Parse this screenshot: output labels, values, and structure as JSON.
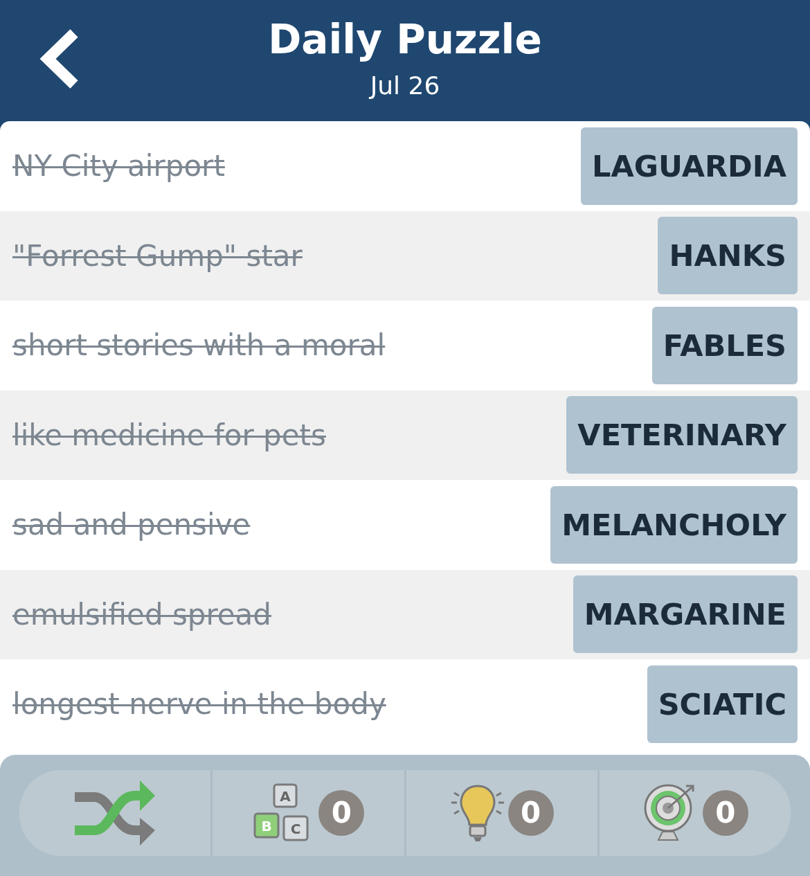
{
  "header": {
    "title": "Daily Puzzle",
    "date": "Jul 26"
  },
  "clues": [
    {
      "clue": "NY City airport",
      "answer": "LAGUARDIA",
      "solved": true
    },
    {
      "clue": "\"Forrest Gump\" star",
      "answer": "HANKS",
      "solved": true
    },
    {
      "clue": "short stories with a moral",
      "answer": "FABLES",
      "solved": true
    },
    {
      "clue": "like medicine for pets",
      "answer": "VETERINARY",
      "solved": true
    },
    {
      "clue": "sad and pensive",
      "answer": "MELANCHOLY",
      "solved": true
    },
    {
      "clue": "emulsified spread",
      "answer": "MARGARINE",
      "solved": true
    },
    {
      "clue": "longest nerve in the body",
      "answer": "SCIATIC",
      "solved": true
    }
  ],
  "toolbar": [
    {
      "kind": "shuffle"
    },
    {
      "kind": "letters",
      "letters": [
        "A",
        "B",
        "C"
      ],
      "count": "0"
    },
    {
      "kind": "hint",
      "count": "0"
    },
    {
      "kind": "target",
      "count": "0"
    }
  ]
}
